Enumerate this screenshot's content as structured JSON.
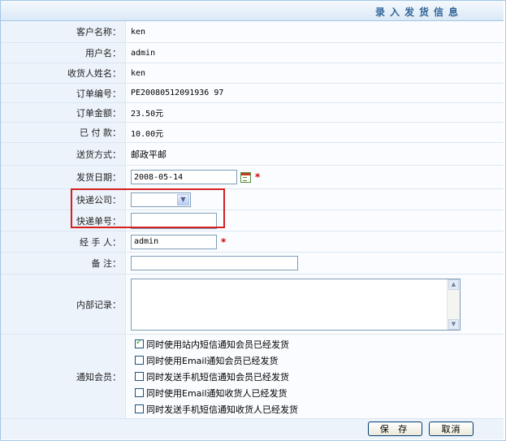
{
  "header": {
    "title": "录入发货信息"
  },
  "fields": {
    "customer_name": {
      "label": "客户名称：",
      "value": "ken"
    },
    "username": {
      "label": "用户名：",
      "value": "admin"
    },
    "consignee": {
      "label": "收货人姓名：",
      "value": "ken"
    },
    "order_no": {
      "label": "订单编号：",
      "value": "PE20080512091936 97"
    },
    "order_amount": {
      "label": "订单金额：",
      "value": "23.50元"
    },
    "paid": {
      "label": "已 付 款：",
      "value": "10.00元"
    },
    "delivery_method": {
      "label": "送货方式：",
      "value": "邮政平邮"
    },
    "ship_date": {
      "label": "发货日期：",
      "value": "2008-05-14",
      "required": "*"
    },
    "courier_company": {
      "label": "快递公司：",
      "value": ""
    },
    "tracking_no": {
      "label": "快递单号：",
      "value": ""
    },
    "handler": {
      "label": "经 手 人：",
      "value": "admin",
      "required": "*"
    },
    "remark": {
      "label": "备 注：",
      "value": ""
    },
    "internal_record": {
      "label": "内部记录：",
      "value": ""
    }
  },
  "notify": {
    "label": "通知会员：",
    "options": [
      {
        "label": "同时使用站内短信通知会员已经发货",
        "checked": true
      },
      {
        "label": "同时使用Email通知会员已经发货",
        "checked": false
      },
      {
        "label": "同时发送手机短信通知会员已经发货",
        "checked": false
      },
      {
        "label": "同时使用Email通知收货人已经发货",
        "checked": false
      },
      {
        "label": "同时发送手机短信通知收货人已经发货",
        "checked": false
      }
    ]
  },
  "buttons": {
    "save": "保 存",
    "cancel": "取消"
  },
  "colors": {
    "label_bg": "#ecf3fb",
    "title_color": "#336699",
    "required": "#dd0000",
    "highlight": "#d42020"
  }
}
